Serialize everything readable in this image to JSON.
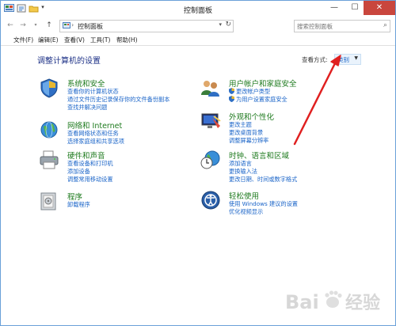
{
  "window": {
    "title": "控制面板",
    "minimize": "—",
    "maximize": "☐",
    "close": "✕"
  },
  "address": {
    "crumb": "控制面板",
    "separator": "›"
  },
  "search": {
    "placeholder": "搜索控制面板"
  },
  "menu": [
    "文件(F)",
    "编辑(E)",
    "查看(V)",
    "工具(T)",
    "帮助(H)"
  ],
  "heading": "调整计算机的设置",
  "view_by": {
    "label": "查看方式:",
    "value": "类别"
  },
  "categories": [
    {
      "title": "系统和安全",
      "links": [
        "查看你的计算机状态",
        "通过文件历史记录保存你的文件备份副本",
        "查找并解决问题"
      ],
      "icon": "shield-icon"
    },
    {
      "title": "网络和 Internet",
      "links": [
        "查看网络状态和任务",
        "选择家庭组和共享选项"
      ],
      "icon": "network-globe-icon"
    },
    {
      "title": "硬件和声音",
      "links": [
        "查看设备和打印机",
        "添加设备",
        "调整常用移动设置"
      ],
      "icon": "printer-icon"
    },
    {
      "title": "程序",
      "links": [
        "卸载程序"
      ],
      "icon": "programs-icon"
    },
    {
      "title": "用户帐户和家庭安全",
      "links": [
        "更改帐户类型",
        "为用户设置家庭安全"
      ],
      "icon": "users-icon"
    },
    {
      "title": "外观和个性化",
      "links": [
        "更改主题",
        "更改桌面背景",
        "调整屏幕分辨率"
      ],
      "icon": "display-icon"
    },
    {
      "title": "时钟、语言和区域",
      "links": [
        "添加语言",
        "更换输入法",
        "更改日期、时间或数字格式"
      ],
      "icon": "clock-globe-icon"
    },
    {
      "title": "轻松使用",
      "links": [
        "使用 Windows 建议的设置",
        "优化视频显示"
      ],
      "icon": "accessibility-icon"
    }
  ],
  "watermark": "Baidu 经验",
  "colors": {
    "category_title": "#1e7a1e",
    "link": "#1a64c8",
    "heading": "#1e3287",
    "annotation_arrow": "#e02020",
    "close_button": "#c9463d"
  }
}
